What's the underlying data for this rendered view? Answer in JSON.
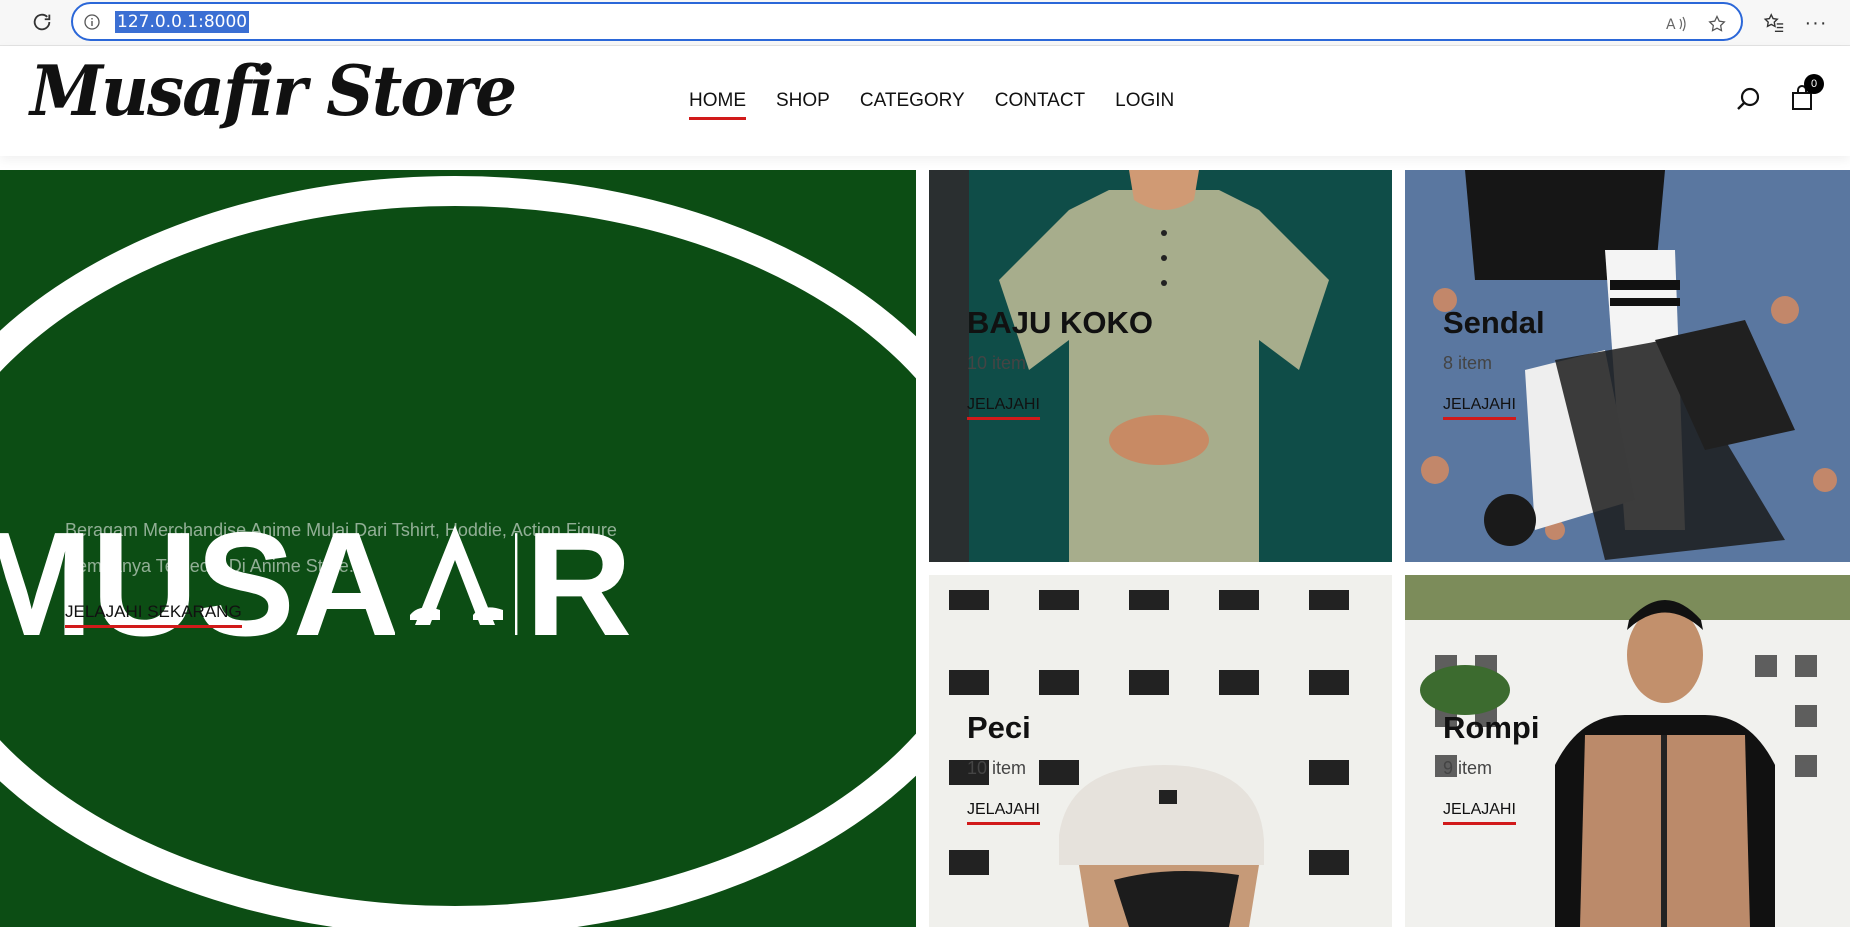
{
  "browser": {
    "url": "127.0.0.1:8000"
  },
  "site": {
    "logo": "Musafir Store",
    "nav": [
      "HOME",
      "SHOP",
      "CATEGORY",
      "CONTACT",
      "LOGIN"
    ],
    "cart_count": "0"
  },
  "hero": {
    "brand_text": "MUSAFIR",
    "description": "Beragam Merchandise Anime Mulai Dari Tshirt, Hoddie, Action Figure Semuanya Tersedia Di Anime Store.",
    "cta": "JELAJAHI SEKARANG"
  },
  "categories": [
    {
      "title": "BAJU KOKO",
      "count": "10 item",
      "link": "JELAJAHI"
    },
    {
      "title": "Sendal",
      "count": "8 item",
      "link": "JELAJAHI"
    },
    {
      "title": "Peci",
      "count": "10 item",
      "link": "JELAJAHI"
    },
    {
      "title": "Rompi",
      "count": "9 item",
      "link": "JELAJAHI"
    }
  ],
  "colors": {
    "accent": "#d11a1a",
    "hero_bg": "#0c4d14",
    "address_focus": "#2b67d8"
  }
}
